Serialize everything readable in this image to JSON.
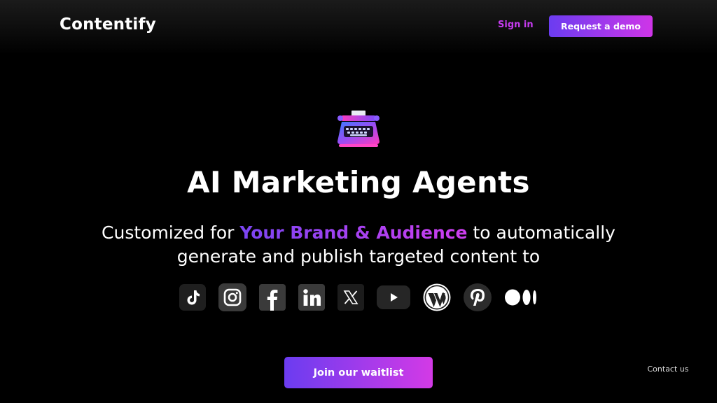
{
  "header": {
    "brand": "Contentify",
    "signin_label": "Sign in",
    "demo_label": "Request a demo"
  },
  "hero": {
    "icon": "typewriter-icon",
    "headline": "AI Marketing Agents",
    "sub_prefix": "Customized for ",
    "sub_highlight": "Your Brand & Audience",
    "sub_suffix": " to automatically generate and publish targeted content to"
  },
  "platforms": [
    {
      "name": "tiktok-icon"
    },
    {
      "name": "instagram-icon"
    },
    {
      "name": "facebook-icon"
    },
    {
      "name": "linkedin-icon"
    },
    {
      "name": "x-icon"
    },
    {
      "name": "youtube-icon"
    },
    {
      "name": "wordpress-icon"
    },
    {
      "name": "pinterest-icon"
    },
    {
      "name": "medium-icon"
    }
  ],
  "cta": {
    "waitlist_label": "Join our waitlist",
    "contact_label": "Contact us"
  },
  "colors": {
    "background": "#000000",
    "accent_start": "#6b3cf0",
    "accent_end": "#cf35e8",
    "signin_text": "#c63bf0"
  }
}
